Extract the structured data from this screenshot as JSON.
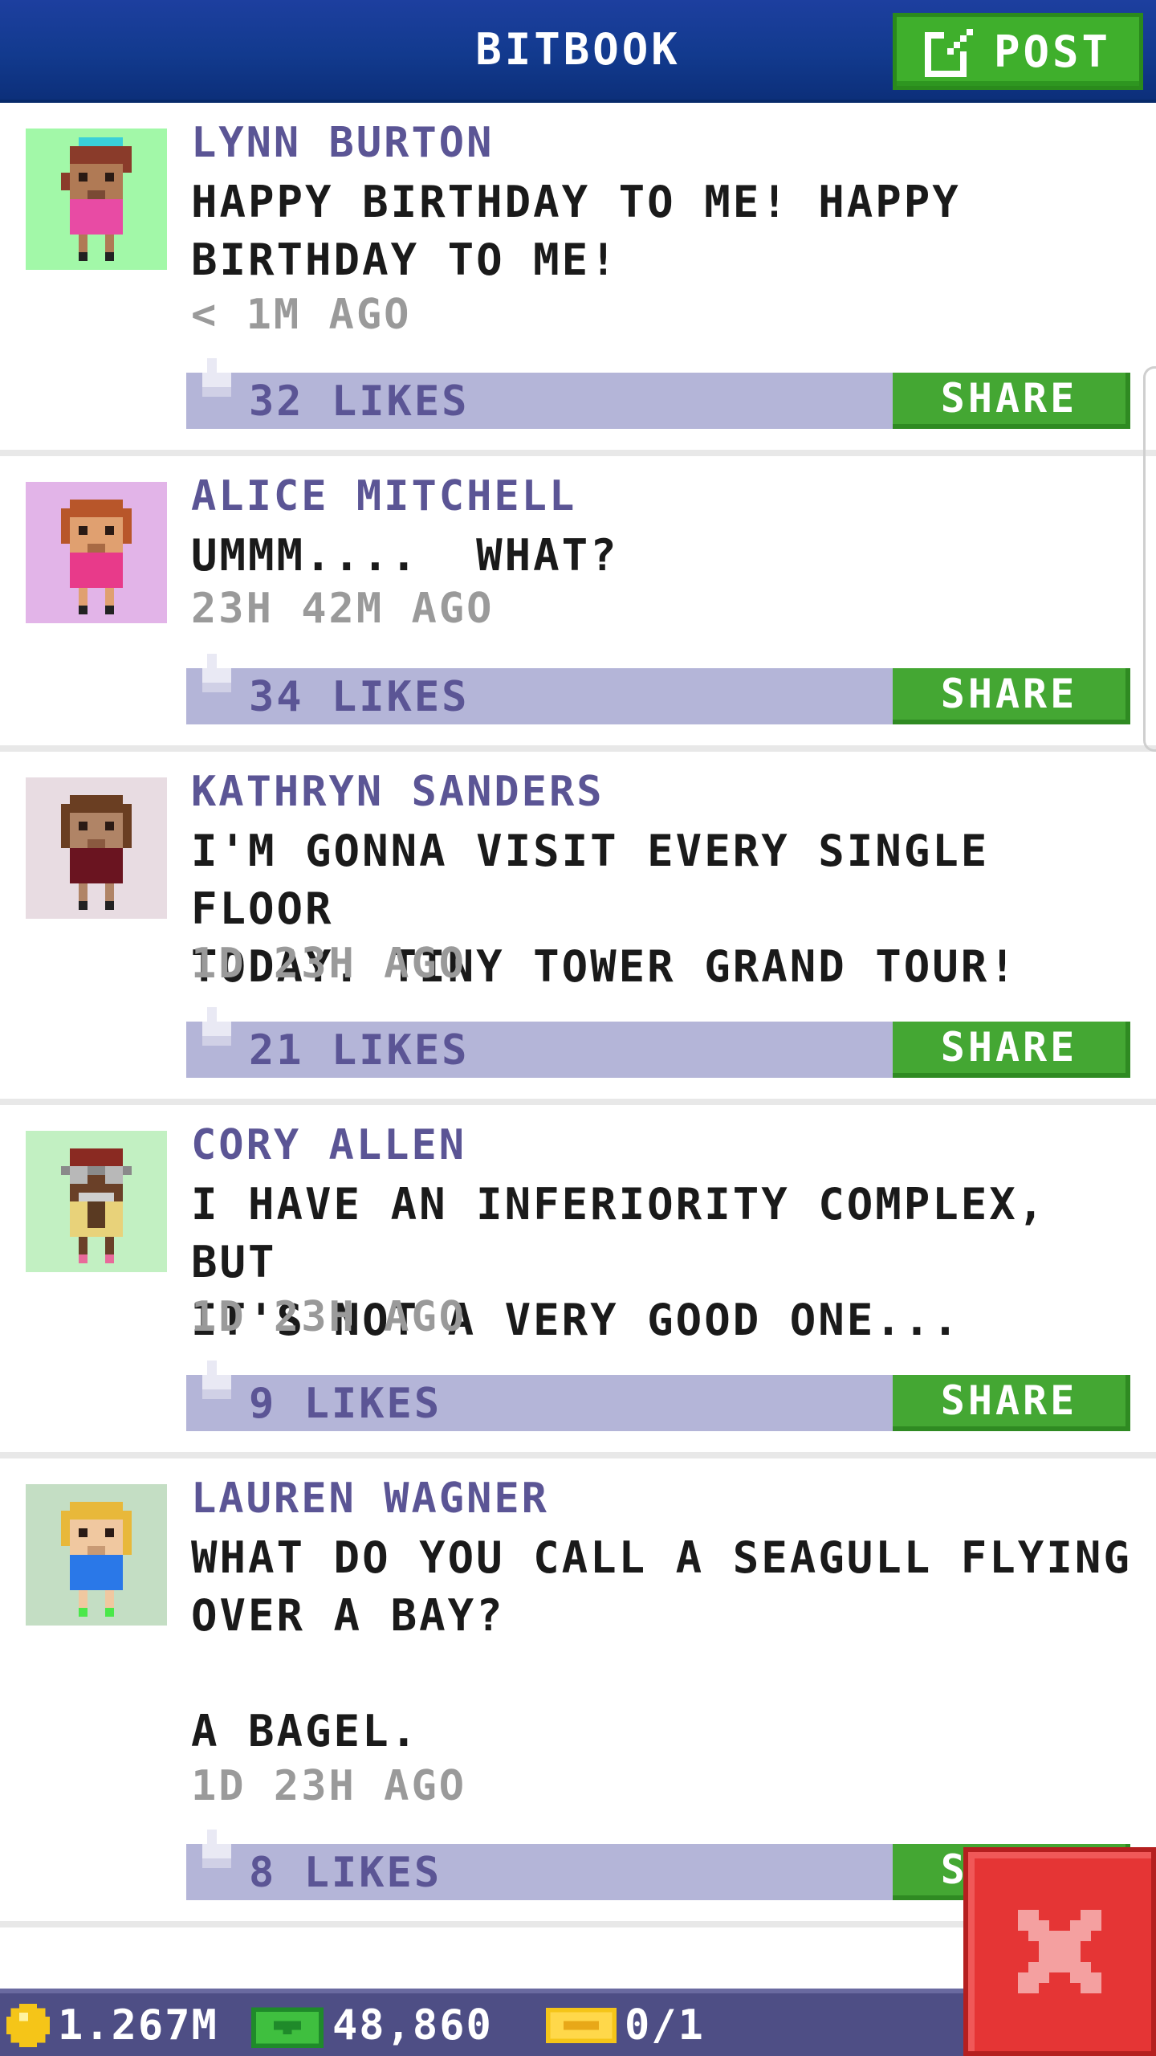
{
  "header": {
    "title": "BITBOOK",
    "post_label": "POST"
  },
  "feed": [
    {
      "author": "LYNN BURTON",
      "message": "HAPPY BIRTHDAY TO ME! HAPPY\nBIRTHDAY TO ME!",
      "time": "< 1M AGO",
      "likes": "32 LIKES",
      "share_label": "SHARE",
      "avatar_bg": "#a2f8a8"
    },
    {
      "author": "ALICE MITCHELL",
      "message": "UMMM....  WHAT?",
      "time": "23H 42M AGO",
      "likes": "34 LIKES",
      "share_label": "SHARE",
      "avatar_bg": "#e2b4e8"
    },
    {
      "author": "KATHRYN SANDERS",
      "message": "I'M GONNA VISIT EVERY SINGLE FLOOR\nTODAY. TINY TOWER GRAND TOUR!",
      "time": "1D 23H AGO",
      "likes": "21 LIKES",
      "share_label": "SHARE",
      "avatar_bg": "#e8dce2"
    },
    {
      "author": "CORY ALLEN",
      "message": "I HAVE AN INFERIORITY COMPLEX, BUT\nIT'S NOT A VERY GOOD ONE...",
      "time": "1D 23H AGO",
      "likes": "9 LIKES",
      "share_label": "SHARE",
      "avatar_bg": "#c2f0c2"
    },
    {
      "author": "LAUREN WAGNER",
      "message": "WHAT DO YOU CALL A SEAGULL FLYING\nOVER A BAY?\n\nA BAGEL.",
      "time": "1D 23H AGO",
      "likes": "8 LIKES",
      "share_label": "SHARE",
      "avatar_bg": "#c4dec4"
    }
  ],
  "status": {
    "coins": "1.267M",
    "bux": "48,860",
    "tickets": "0/1"
  },
  "colors": {
    "header_blue": "#123a8e",
    "post_green": "#3faf2c",
    "likes_bar": "#b4b5d8",
    "author_purple": "#5b5595",
    "close_red": "#e53535"
  },
  "icons": {
    "post": "edit-icon",
    "like": "thumbs-up-icon",
    "coin": "coin-icon",
    "bux": "bux-icon",
    "ticket": "ticket-icon",
    "close": "close-icon"
  }
}
